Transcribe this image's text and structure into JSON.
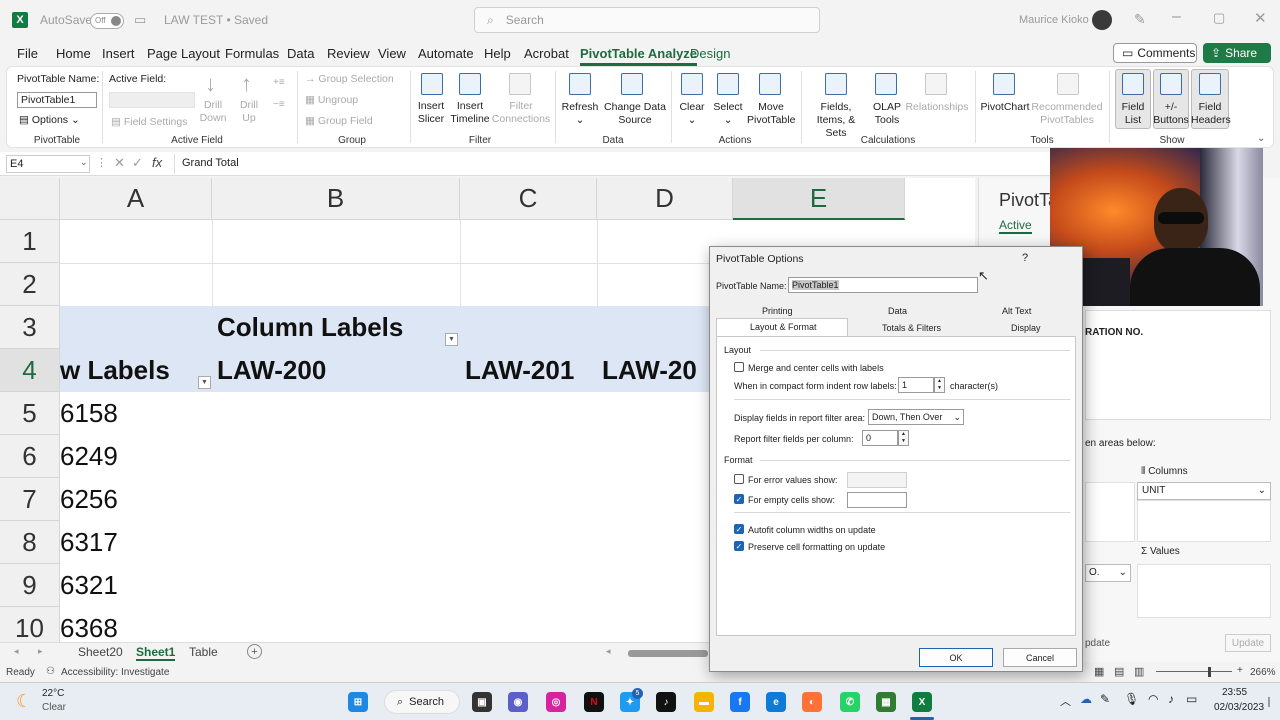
{
  "titlebar": {
    "autosave_label": "AutoSave",
    "autosave_state": "Off",
    "doc_title": "LAW TEST • Saved",
    "search_placeholder": "Search",
    "user_name": "Maurice Kioko"
  },
  "menu": {
    "tabs": [
      "File",
      "Home",
      "Insert",
      "Page Layout",
      "Formulas",
      "Data",
      "Review",
      "View",
      "Automate",
      "Help",
      "Acrobat",
      "PivotTable Analyze",
      "Design"
    ],
    "comments_label": "Comments",
    "share_label": "Share"
  },
  "ribbon": {
    "pivot_name_label": "PivotTable Name:",
    "pivot_name_value": "PivotTable1",
    "options_label": "Options",
    "group_pivottable": "PivotTable",
    "active_field_label": "Active Field:",
    "field_settings": "Field Settings",
    "drill_down": "Drill Down",
    "drill_up": "Drill Up",
    "group_active_field": "Active Field",
    "group_selection": "Group Selection",
    "ungroup": "Ungroup",
    "group_field": "Group Field",
    "group_group": "Group",
    "insert_slicer": "Insert Slicer",
    "insert_timeline": "Insert Timeline",
    "filter_connections": "Filter Connections",
    "group_filter": "Filter",
    "refresh": "Refresh",
    "change_data_source": "Change Data Source",
    "group_data": "Data",
    "clear": "Clear",
    "select": "Select",
    "move_pivottable": "Move PivotTable",
    "group_actions": "Actions",
    "fields_items_sets": "Fields, Items, & Sets",
    "olap_tools": "OLAP Tools",
    "relationships": "Relationships",
    "group_calculations": "Calculations",
    "pivotchart": "PivotChart",
    "recommended_pivottables": "Recommended PivotTables",
    "group_tools": "Tools",
    "field_list": "Field List",
    "plus_minus_buttons": "+/- Buttons",
    "field_headers": "Field Headers",
    "group_show": "Show"
  },
  "formula_bar": {
    "name_box": "E4",
    "fx": "fx",
    "content": "Grand Total"
  },
  "grid": {
    "columns": [
      "A",
      "B",
      "C",
      "D",
      "E"
    ],
    "rows": [
      "1",
      "2",
      "3",
      "4",
      "5",
      "6",
      "7",
      "8",
      "9",
      "10"
    ],
    "column_labels": "Column Labels",
    "row_labels": "w Labels",
    "col_b_header": "LAW-200",
    "col_c_header": "LAW-201",
    "col_d_header": "LAW-20",
    "row_values": [
      "6158",
      "6249",
      "6256",
      "6317",
      "6321",
      "6368"
    ]
  },
  "sheets": {
    "tabs": [
      "Sheet20",
      "Sheet1",
      "Table"
    ],
    "active": "Sheet1"
  },
  "status": {
    "ready": "Ready",
    "accessibility": "Accessibility: Investigate",
    "zoom": "266%"
  },
  "pane": {
    "title": "PivotTa",
    "active_tab": "Active",
    "field_text": "RATION NO.",
    "areas_text": "en areas below:",
    "columns_label": "Columns",
    "columns_value": "UNIT",
    "values_label": "Values",
    "rows_value": "O.",
    "update_label": "pdate",
    "update_button": "Update"
  },
  "dialog": {
    "title": "PivotTable Options",
    "help": "?",
    "name_label": "PivotTable Name:",
    "name_value": "PivotTable1",
    "tabs_top": [
      "Printing",
      "Data",
      "Alt Text"
    ],
    "tabs_bottom": [
      "Layout & Format",
      "Totals & Filters",
      "Display"
    ],
    "section_layout": "Layout",
    "merge_label": "Merge and center cells with labels",
    "indent_label": "When in compact form indent row labels:",
    "indent_value": "1",
    "indent_unit": "character(s)",
    "display_fields_label": "Display fields in report filter area:",
    "display_fields_value": "Down, Then Over",
    "filter_fields_label": "Report filter fields per column:",
    "filter_fields_value": "0",
    "section_format": "Format",
    "error_values_label": "For error values show:",
    "empty_cells_label": "For empty cells show:",
    "autofit_label": "Autofit column widths on update",
    "preserve_label": "Preserve cell formatting on update",
    "ok": "OK",
    "cancel": "Cancel"
  },
  "taskbar": {
    "temp": "22°C",
    "weather": "Clear",
    "search": "Search",
    "time": "23:55",
    "date": "02/03/2023",
    "badge": "5"
  },
  "colors": {
    "accent": "#1e6b3f",
    "highlight": "#dde6f4",
    "checkbox": "#1e64b4"
  }
}
